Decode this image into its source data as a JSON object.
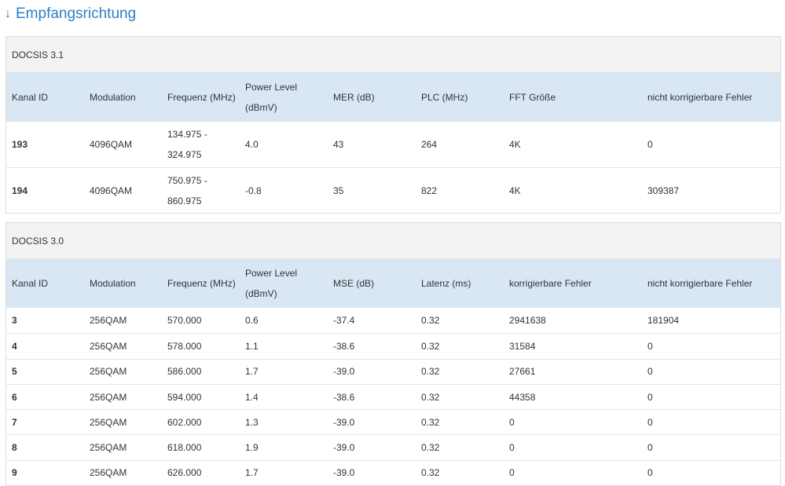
{
  "heading": {
    "arrow": "↓",
    "label": "Empfangsrichtung"
  },
  "docsis31": {
    "title": "DOCSIS 3.1",
    "headers": [
      "Kanal ID",
      "Modulation",
      "Frequenz (MHz)",
      "Power Level",
      "(dBmV)",
      "MER (dB)",
      "PLC (MHz)",
      "FFT Größe",
      "nicht korrigierbare Fehler"
    ],
    "rows": [
      {
        "id": "193",
        "mod": "4096QAM",
        "freq1": "134.975 -",
        "freq2": "324.975",
        "power": "4.0",
        "mer": "43",
        "plc": "264",
        "fft": "4K",
        "errors": "0"
      },
      {
        "id": "194",
        "mod": "4096QAM",
        "freq1": "750.975 -",
        "freq2": "860.975",
        "power": "-0.8",
        "mer": "35",
        "plc": "822",
        "fft": "4K",
        "errors": "309387"
      }
    ]
  },
  "docsis30": {
    "title": "DOCSIS 3.0",
    "headers": [
      "Kanal ID",
      "Modulation",
      "Frequenz (MHz)",
      "Power Level",
      "(dBmV)",
      "MSE (dB)",
      "Latenz (ms)",
      "korrigierbare Fehler",
      "nicht korrigierbare Fehler"
    ],
    "rows": [
      {
        "id": "3",
        "mod": "256QAM",
        "freq": "570.000",
        "power": "0.6",
        "mse": "-37.4",
        "latency": "0.32",
        "corr": "2941638",
        "uncorr": "181904"
      },
      {
        "id": "4",
        "mod": "256QAM",
        "freq": "578.000",
        "power": "1.1",
        "mse": "-38.6",
        "latency": "0.32",
        "corr": "31584",
        "uncorr": "0"
      },
      {
        "id": "5",
        "mod": "256QAM",
        "freq": "586.000",
        "power": "1.7",
        "mse": "-39.0",
        "latency": "0.32",
        "corr": "27661",
        "uncorr": "0"
      },
      {
        "id": "6",
        "mod": "256QAM",
        "freq": "594.000",
        "power": "1.4",
        "mse": "-38.6",
        "latency": "0.32",
        "corr": "44358",
        "uncorr": "0"
      },
      {
        "id": "7",
        "mod": "256QAM",
        "freq": "602.000",
        "power": "1.3",
        "mse": "-39.0",
        "latency": "0.32",
        "corr": "0",
        "uncorr": "0"
      },
      {
        "id": "8",
        "mod": "256QAM",
        "freq": "618.000",
        "power": "1.9",
        "mse": "-39.0",
        "latency": "0.32",
        "corr": "0",
        "uncorr": "0"
      },
      {
        "id": "9",
        "mod": "256QAM",
        "freq": "626.000",
        "power": "1.7",
        "mse": "-39.0",
        "latency": "0.32",
        "corr": "0",
        "uncorr": "0"
      }
    ]
  }
}
